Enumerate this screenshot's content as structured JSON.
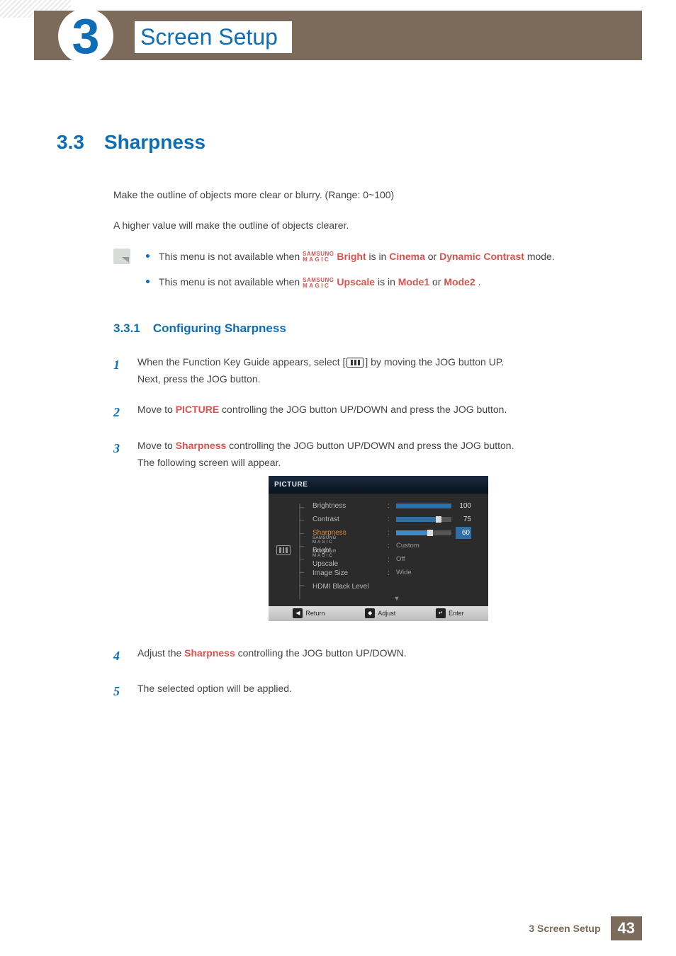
{
  "chapter": {
    "number": "3",
    "title": "Screen Setup"
  },
  "section": {
    "number": "3.3",
    "title": "Sharpness"
  },
  "intro": {
    "p1": "Make the outline of objects more clear or blurry. (Range: 0~100)",
    "p2": "A higher value will make the outline of objects clearer."
  },
  "notes": {
    "n1_pre": "This menu is not available when ",
    "n1_label": "Bright",
    "n1_mid": " is in ",
    "n1_a": "Cinema",
    "n1_or": " or ",
    "n1_b": "Dynamic Contrast",
    "n1_post": " mode.",
    "n2_pre": "This menu is not available when ",
    "n2_label": "Upscale",
    "n2_mid": " is in ",
    "n2_a": "Mode1",
    "n2_or": " or ",
    "n2_b": "Mode2",
    "n2_post": "."
  },
  "magic": {
    "top": "SAMSUNG",
    "bot": "MAGIC"
  },
  "subsection": {
    "number": "3.3.1",
    "title": "Configuring Sharpness"
  },
  "steps": {
    "s1a": "When the Function Key Guide appears, select ",
    "s1b": " by moving the JOG button UP.",
    "s1c": "Next, press the JOG button.",
    "s2a": "Move to ",
    "s2_label": "PICTURE",
    "s2b": " controlling the JOG button UP/DOWN and press the JOG button.",
    "s3a": "Move to ",
    "s3_label": "Sharpness",
    "s3b": " controlling the JOG button UP/DOWN and press the JOG button.",
    "s3c": "The following screen will appear.",
    "s4a": "Adjust the ",
    "s4_label": "Sharpness",
    "s4b": " controlling the JOG button UP/DOWN.",
    "s5": "The selected option will be applied."
  },
  "osd": {
    "title": "PICTURE",
    "rows": {
      "brightness": {
        "label": "Brightness",
        "value": 100,
        "fill": 100
      },
      "contrast": {
        "label": "Contrast",
        "value": 75,
        "fill": 75
      },
      "sharpness": {
        "label": "Sharpness",
        "value": 60,
        "fill": 60
      },
      "bright": {
        "label": "Bright",
        "value": "Custom"
      },
      "upscale": {
        "label": "Upscale",
        "value": "Off"
      },
      "imagesize": {
        "label": "Image Size",
        "value": "Wide"
      },
      "hdmi": {
        "label": "HDMI Black Level",
        "value": ""
      }
    },
    "footer": {
      "return": "Return",
      "adjust": "Adjust",
      "enter": "Enter"
    }
  },
  "footer": {
    "label": "3 Screen Setup",
    "page": "43"
  }
}
